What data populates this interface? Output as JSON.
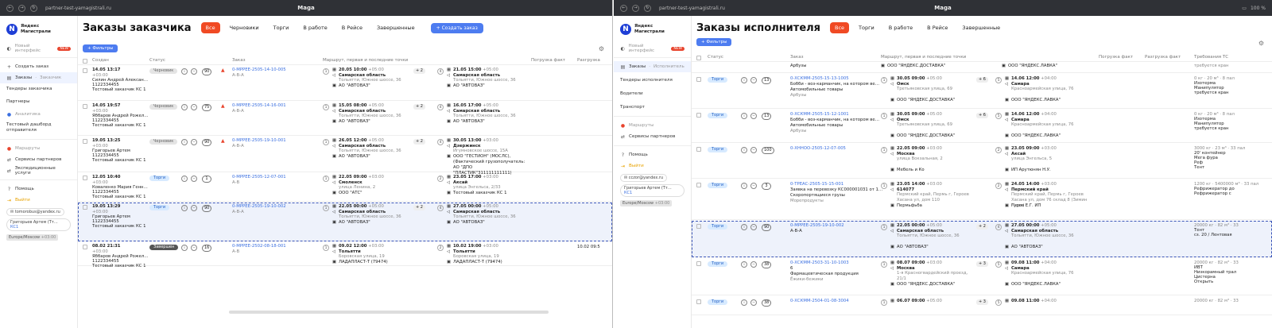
{
  "left": {
    "chrome": {
      "url": "partner-test-yamagistrali.ru",
      "title": "Maga"
    },
    "logo": {
      "line1": "Яндекс",
      "line2": "Магистрали"
    },
    "sidebar": {
      "new_interface": "Новый интерфейс",
      "new_badge": "NEW",
      "items": [
        "Создать заказ",
        "Заказы",
        "Тендеры заказчика",
        "Партнеры",
        "Аналитика",
        "Тестовый дашборд отправителя",
        "Маршруты",
        "Сервисы партнеров",
        "Экспедиционные услуги",
        "Помощь",
        "Выйти"
      ],
      "orders_sub": "Заказчик",
      "email": "tomorobus@yandex.ru",
      "user": "Григорьев Артем (Тт…",
      "user_tag": "КС1",
      "tz": "Europe/Moscow",
      "tz_off": "+03:00"
    },
    "title": "Заказы заказчика",
    "tabs": [
      "Все",
      "Черновики",
      "Торги",
      "В работе",
      "В Рейсе",
      "Завершенные"
    ],
    "create_btn": "+ Создать заказ",
    "filters": "+ Фильтры",
    "cols": [
      "Создан",
      "Статус",
      "Заказ",
      "Маршрут, первая и последние точки",
      "Погрузка факт",
      "Разгрузка"
    ],
    "rows": [
      {
        "date": "14.05 13:17",
        "tz": "+03:00",
        "name": "Силин Андрей Алексан…",
        "phone": "1122334455",
        "org": "Тестовый заказчик КС 1",
        "status": "Черновик",
        "count": "90",
        "warn": "▲",
        "order": "0-МРРЕЕ-2505-14-10-005",
        "route": "А-В-А",
        "p1": "1",
        "d1": "20.05 10:00",
        "z1": "+05:00",
        "r1": "Самарская область",
        "a1": "Тольятти, Южное шоссе, 36",
        "o1": "АО \"АВТОВАЗ\"",
        "mid": "+ 2",
        "p2": "4",
        "d2": "21.05 15:00",
        "z2": "+05:00",
        "r2": "Самарская область",
        "a2": "Тольятти, Южное шоссе, 36",
        "o2": "АО \"АВТОВАЗ\"",
        "fact": ""
      },
      {
        "date": "14.05 19:57",
        "tz": "+03:00",
        "name": "Яббаров Андрей Рожел…",
        "phone": "1122334455",
        "org": "Тестовый заказчик КС 1",
        "status": "Черновик",
        "count": "75",
        "warn": "▲",
        "order": "0-МРРЕЕ-2505-14-16-001",
        "route": "А-В-А",
        "p1": "1",
        "d1": "15.05 08:00",
        "z1": "+05:00",
        "r1": "Самарская область",
        "a1": "Тольятти, Южное шоссе, 36",
        "o1": "АО \"АВТОВАЗ\"",
        "mid": "+ 2",
        "p2": "4",
        "d2": "16.05 17:00",
        "z2": "+05:00",
        "r2": "Самарская область",
        "a2": "Тольятти, Южное шоссе, 36",
        "o2": "АО \"АВТОВАЗ\"",
        "fact": ""
      },
      {
        "date": "19.05 13:25",
        "tz": "+03:00",
        "name": "Григорьев Артем",
        "phone": "1122334455",
        "org": "Тестовый заказчик КС 1",
        "status": "Черновик",
        "count": "90",
        "warn": "▲",
        "order": "0-МРРЕЕ-2505-19-10-001",
        "route": "А-В-А",
        "p1": "1",
        "d1": "26.05 12:00",
        "z1": "+05:00",
        "r1": "Самарская область",
        "a1": "Тольятти, Южное шоссе, 36",
        "o1": "АО \"АВТОВАЗ\"",
        "mid": "+ 2",
        "p2": "4",
        "d2": "30.05 13:00",
        "z2": "+03:00",
        "r2": "Дзержинск",
        "a2": "Игумновское шоссе, 15А",
        "o2": "ООО \"ГЕСТИОН\" (МОСЛС), (Фактический грузополучатель: АО \"ДПО \"ПЛАСТИК\"311111111111)",
        "fact": ""
      },
      {
        "date": "12.05 10:40",
        "tz": "+03:00",
        "name": "Коваленко Мария Генн…",
        "phone": "1122334455",
        "org": "Тестовый заказчик КС 1",
        "status": "Торги",
        "count": "1",
        "warn": "",
        "order": "0-МРРЕЕ-2505-12-07-001",
        "route": "А-В",
        "p1": "1",
        "d1": "22.05 09:00",
        "z1": "+03:00",
        "r1": "Смоленск",
        "a1": "улица Ленина, 2",
        "o1": "ООО \"АТС\"",
        "mid": "",
        "p2": "2",
        "d2": "23.05 17:00",
        "z2": "+03:00",
        "r2": "Аксай",
        "a2": "улица Энгельса, 2/33",
        "o2": "Тестовый заказчик КС 1",
        "fact": ""
      },
      {
        "date": "19.05 13:29",
        "tz": "+03:00",
        "name": "Григорьев Артем",
        "phone": "1122334455",
        "org": "Тестовый заказчик КС 1",
        "status": "Торги",
        "count": "90",
        "warn": "",
        "order": "0-МРРЕЕ-2505-19-10-002",
        "route": "А-В-А",
        "p1": "1",
        "d1": "22.05 00:00",
        "z1": "+05:00",
        "r1": "Самарская область",
        "a1": "Тольятти, Южное шоссе, 36",
        "o1": "АО \"АВТОВАЗ\"",
        "mid": "+ 2",
        "p2": "4",
        "d2": "27.05 00:00",
        "z2": "+05:00",
        "r2": "Самарская область",
        "a2": "Тольятти, Южное шоссе, 36",
        "o2": "АО \"АВТОВАЗ\"",
        "fact": ""
      },
      {
        "date": "08.02 21:31",
        "tz": "+03:00",
        "name": "Яббаров Андрей Рожел…",
        "phone": "1122334455",
        "org": "Тестовый заказчик КС 1",
        "status": "Завершен",
        "count": "16",
        "warn": "",
        "order": "0-МРРЕЕ-2502-08-18-001",
        "route": "А-В",
        "p1": "1",
        "d1": "09.02 12:00",
        "z1": "+03:00",
        "r1": "Тольятти",
        "a1": "Боровская улица, 19",
        "o1": "ЛАДАПЛАСТ-Т (79474)",
        "mid": "",
        "p2": "2",
        "d2": "10.02 19:00",
        "z2": "+03:00",
        "r2": "Тольятти",
        "a2": "Боровская улица, 19",
        "o2": "ЛАДАПЛАСТ-Т (79474)",
        "fact": "10.02 09:5"
      }
    ]
  },
  "right": {
    "chrome": {
      "url": "partner-test-yamagistrali.ru",
      "title": "Maga",
      "battery": "100 %"
    },
    "logo": {
      "line1": "Яндекс",
      "line2": "Магистрали"
    },
    "sidebar": {
      "new_interface": "Новый интерфейс",
      "new_badge": "NEW",
      "items": [
        "Заказы",
        "Тендеры исполнителя",
        "Водители",
        "Транспорт",
        "Маршруты",
        "Сервисы партнеров",
        "Помощь",
        "Выйти"
      ],
      "orders_sub": "Исполнитель",
      "email": "cczor@yandex.ru",
      "user": "Григорьев Артем (Тт…",
      "user_tag": "КС1",
      "tz": "Europe/Moscow",
      "tz_off": "+03:00"
    },
    "title": "Заказы исполнителя",
    "tabs": [
      "Все",
      "Торги",
      "В работе",
      "В Рейсе",
      "Завершенные"
    ],
    "filters": "+ Фильтры",
    "cols": [
      "Статус",
      "Заказ",
      "Маршрут, первая и последние точки",
      "Погрузка факт",
      "Разгрузка факт",
      "Требования ТС"
    ],
    "top": {
      "desc": "Арбузы",
      "o1": "ООО \"ЯНДЕКС.ДОСТАВКА\"",
      "o2": "ООО \"ЯНДЕКС.ЛАВКА\"",
      "req": "требуется кран"
    },
    "rows": [
      {
        "status": "Торги",
        "count": "13",
        "order": "0-ХСКММ-2505-15-13-1005",
        "desc": "Бобби - воз-карманчик, на котором ве…",
        "cat": "Автомобильные товары",
        "cargo": "Арбузы",
        "p1": "1",
        "d1": "30.05 09:00",
        "z1": "+05:00",
        "r1": "Омск",
        "a1": "Третьяковская улица, 69",
        "o1": "ООО \"ЯНДЕКС.ДОСТАВКА\"",
        "mid": "+ 6",
        "p2": "5",
        "d2": "14.06 12:00",
        "z2": "+04:00",
        "r2": "Самара",
        "a2": "Красноармейская улица, 76",
        "o2": "ООО \"ЯНДЕКС.ЛАВКА\"",
        "req": [
          "0 кг · 20 м³ · 8 пал",
          "Изотерма",
          "Манипулятор",
          "требуется кран"
        ]
      },
      {
        "status": "Торги",
        "count": "13",
        "order": "0-ХСКММ-2505-15-12-1001",
        "desc": "Бобби - воз-карманчик, на котором ве…",
        "cat": "Автомобильные товары",
        "cargo": "Арбузы",
        "p1": "1",
        "d1": "30.05 09:00",
        "z1": "+05:00",
        "r1": "Омск",
        "a1": "Третьяковская улица, 69",
        "o1": "ООО \"ЯНДЕКС.ДОСТАВКА\"",
        "mid": "+ 6",
        "p2": "5",
        "d2": "14.06 12:00",
        "z2": "+04:00",
        "r2": "Самара",
        "a2": "Красноармейская улица, 76",
        "o2": "ООО \"ЯНДЕКС.ЛАВКА\"",
        "req": [
          "0 кг · 20 м³ · 8 пал",
          "Изотерма",
          "Манипулятор",
          "требуется кран"
        ]
      },
      {
        "status": "Торги",
        "count": "100",
        "order": "0-ХННОО-2505-12-07-005",
        "desc": "",
        "cat": "",
        "cargo": "",
        "p1": "1",
        "d1": "22.05 09:00",
        "z1": "+03:00",
        "r1": "Москва",
        "a1": "улица Вокзальная, 2",
        "o1": "Мебель и Ко",
        "mid": "",
        "p2": "2",
        "d2": "23.05 09:00",
        "z2": "+03:00",
        "r2": "Аксай",
        "a2": "улица Энгельса, 5",
        "o2": "ИП Арутюнян Н.У.",
        "req": [
          "3000 кг · 23 м³ · 33 пал",
          "20' контейнер",
          "Мега фура",
          "Реф",
          "Тент"
        ]
      },
      {
        "status": "Торги",
        "count": "3",
        "order": "0-ТРЕАС-2505-15-15-001",
        "desc": "Заявка на перевозку КС000001031 от 1…",
        "cat": "Скоропортящиеся грузы",
        "cargo": "Морепродукты",
        "p1": "1",
        "d1": "23.05 14:00",
        "z1": "+03:00",
        "r1": "614077",
        "a1": "Пермский край, Пермь г, Героев Хасана ул, дом 110",
        "o1": "Пермьфьба",
        "mid": "",
        "p2": "2",
        "d2": "24.05 14:00",
        "z2": "+03:00",
        "r2": "Пермский край",
        "a2": "Пермский край, Пермь г, Героев Хасана ул, дом 76 склад 8 (Зимин Марк)",
        "o2": "Гуров Е.Г. ИП",
        "req": [
          "1200 кг · 5400000 м³ · 33 пал",
          "Рефрижератор до",
          "Рефрижератор с"
        ]
      },
      {
        "status": "Торги",
        "count": "90",
        "order": "0-МРРЕЕ-2505-19-10-002",
        "desc": "А-В-А",
        "cat": "",
        "cargo": "",
        "p1": "1",
        "d1": "22.05 00:00",
        "z1": "+05:00",
        "r1": "Самарская область",
        "a1": "Тольятти, Южное шоссе, 36",
        "o1": "АО \"АВТОВАЗ\"",
        "mid": "+ 2",
        "p2": "4",
        "d2": "27.05 00:00",
        "z2": "+05:00",
        "r2": "Самарская область",
        "a2": "Тольятти, Южное шоссе, 36",
        "o2": "АО \"АВТОВАЗ\"",
        "req": [
          "20000 кг · 82 м³ · 33",
          "Тент",
          "сз. 20 / Лентовая"
        ]
      },
      {
        "status": "Торги",
        "count": "38",
        "order": "0-ХСКММ-2503-31-10-1003",
        "desc": "6",
        "cat": "Фармацевтическая продукция",
        "cargo": "Ёжики-бежики",
        "p1": "1",
        "d1": "08.07 09:00",
        "z1": "+03:00",
        "r1": "Москва",
        "a1": "1-я Красногвардейский проезд, 21/1",
        "o1": "ООО \"ЯНДЕКС.ДОСТАВКА\"",
        "mid": "+ 3",
        "p2": "5",
        "d2": "09.08 11:00",
        "z2": "+04:00",
        "r2": "Самара",
        "a2": "Красноармейская улица, 76",
        "o2": "ООО \"ЯНДЕКС.ЛАВКА\"",
        "req": [
          "20000 кг · 82 м³ · 33",
          "ИВТ",
          "Низкорамный трал",
          "Цистерна",
          "Открыть"
        ]
      },
      {
        "status": "Торги",
        "count": "38",
        "order": "0-ХСКММ-2504-01-08-3004",
        "desc": "",
        "cat": "",
        "cargo": "",
        "p1": "1",
        "d1": "06.07 09:00",
        "z1": "+05:00",
        "r1": "",
        "a1": "",
        "o1": "",
        "mid": "+ 3",
        "p2": "5",
        "d2": "09.08 11:00",
        "z2": "+04:00",
        "r2": "",
        "a2": "",
        "o2": "",
        "req": [
          "20000 кг · 82 м³ · 33"
        ]
      }
    ]
  }
}
